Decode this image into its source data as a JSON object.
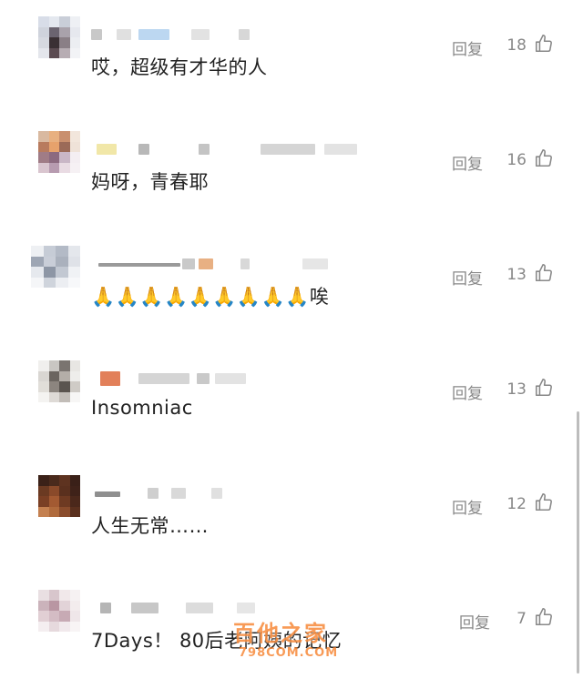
{
  "comments": [
    {
      "text": "哎，超级有才华的人",
      "reply_label": "回复",
      "likes": "18"
    },
    {
      "text": "妈呀，青春耶",
      "reply_label": "回复",
      "likes": "16"
    },
    {
      "text": "🙏🙏🙏🙏🙏🙏🙏🙏🙏唉",
      "reply_label": "回复",
      "likes": "13"
    },
    {
      "text": "Insomniac",
      "reply_label": "回复",
      "likes": "13"
    },
    {
      "text": "人生无常……",
      "reply_label": "回复",
      "likes": "12"
    },
    {
      "text": "7Days！ 80后老阿姨的记忆",
      "reply_label": "回复",
      "likes": "7"
    }
  ],
  "watermark": {
    "title": "百他之家",
    "url": "798COM.COM"
  },
  "colors": {
    "meta": "#888888",
    "text": "#222222"
  },
  "icons": {
    "like": "thumb-up-icon"
  }
}
